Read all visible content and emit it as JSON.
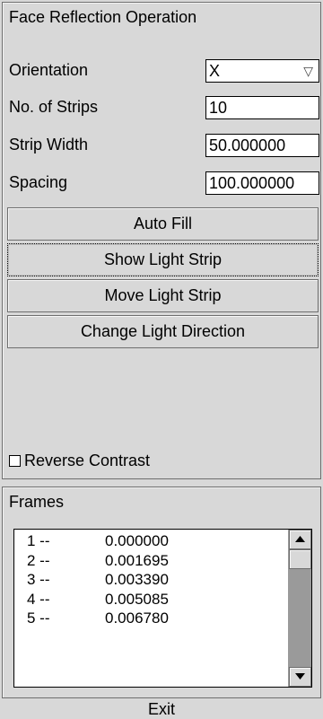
{
  "operation": {
    "title": "Face Reflection Operation",
    "orientation": {
      "label": "Orientation",
      "value": "X",
      "arrow_icon": "triangle-down-icon"
    },
    "strips": {
      "label": "No. of Strips",
      "value": "10"
    },
    "strip_width": {
      "label": "Strip Width",
      "value": "50.000000"
    },
    "spacing": {
      "label": "Spacing",
      "value": "100.000000"
    },
    "buttons": {
      "auto_fill": "Auto Fill",
      "show_light_strip": "Show Light Strip",
      "move_light_strip": "Move Light Strip",
      "change_light_direction": "Change Light Direction"
    },
    "reverse_contrast": {
      "label": "Reverse Contrast",
      "checked": false
    }
  },
  "frames": {
    "title": "Frames",
    "rows": [
      {
        "index": "1 --",
        "value": "0.000000"
      },
      {
        "index": "2 --",
        "value": "0.001695"
      },
      {
        "index": "3 --",
        "value": "0.003390"
      },
      {
        "index": "4 --",
        "value": "0.005085"
      },
      {
        "index": "5 --",
        "value": "0.006780"
      }
    ]
  },
  "exit_label": "Exit"
}
